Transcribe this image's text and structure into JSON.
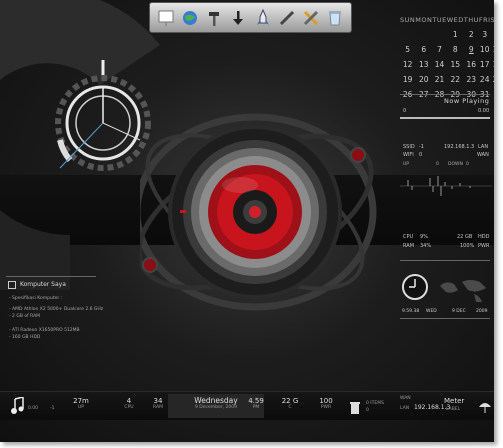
{
  "dock": {
    "icons": [
      "presentation-icon",
      "globe-icon",
      "hammer-icon",
      "download-arrow-icon",
      "rocket-icon",
      "pen-icon",
      "tools-icon",
      "recycle-bin-icon"
    ]
  },
  "calendar": {
    "days_header": [
      "SUN",
      "MON",
      "TUE",
      "WED",
      "THU",
      "FRI",
      "SAT"
    ],
    "weeks": [
      [
        "",
        "",
        "",
        "1",
        "2",
        "3",
        "4"
      ],
      [
        "5",
        "6",
        "7",
        "8",
        "9",
        "10",
        "11"
      ],
      [
        "12",
        "13",
        "14",
        "15",
        "16",
        "17",
        "18"
      ],
      [
        "19",
        "20",
        "21",
        "22",
        "23",
        "24",
        "25"
      ],
      [
        "26",
        "27",
        "28",
        "29",
        "30",
        "31",
        ""
      ]
    ],
    "today": "9"
  },
  "now_playing": {
    "title": "Now Playing",
    "left_value": "0",
    "right_value": "0.00"
  },
  "network": {
    "ssid_label": "SSID",
    "ssid_value": "-1",
    "ip": "192.168.1.3",
    "lan_label": "LAN",
    "wifi_label": "WIFI",
    "wifi_value": "0",
    "wan_label": "WAN",
    "up_label": "UP",
    "up_value": "0",
    "down_label": "DOWN",
    "down_value": "0"
  },
  "system": {
    "cpu_label": "CPU",
    "cpu_value": "9%",
    "ram_label": "RAM",
    "ram_value": "34%",
    "hdd_value": "22 GB",
    "hdd_label": "HDD",
    "pwr_value": "100%",
    "pwr_label": "PWR"
  },
  "clock": {
    "time": "9.59.38",
    "day": "WED",
    "date": "9 DEC",
    "year": "2009"
  },
  "computer": {
    "title": "Komputer Saya",
    "spec_header": "- Spesifikasi Komputer :",
    "lines": [
      "- AMD Athlon X2 5000+ Dualcore 2.6 GHz",
      "- 2 GB of RAM",
      "",
      "- ATI Radeon X1650PRO 512MB",
      "- 160 GB HDD"
    ]
  },
  "bottom": {
    "volume_value": "0.00",
    "volume_sub": "-1",
    "uptime_value": "27m",
    "uptime_label": "UP",
    "cpu_value": "4",
    "cpu_label": "CPU",
    "ram_value": "34",
    "ram_label": "RAM",
    "day": "Wednesday",
    "date": "9 December, 2009",
    "pm_value": "4.59",
    "pm_label": "PM",
    "disk_value": "22 G",
    "disk_label": "C",
    "pwr_value": "100",
    "pwr_label": "PWR",
    "items_value": "0 ITEMS",
    "items_sub": "0",
    "wan_label": "WAN",
    "lan_label": "LAN",
    "ip": "192.168.1.3",
    "meter_label": "Meter",
    "meter_sub": "LABEL"
  },
  "colors": {
    "accent_red": "#c8141c",
    "background": "#1a1a1a",
    "text": "#d8d8d8"
  }
}
